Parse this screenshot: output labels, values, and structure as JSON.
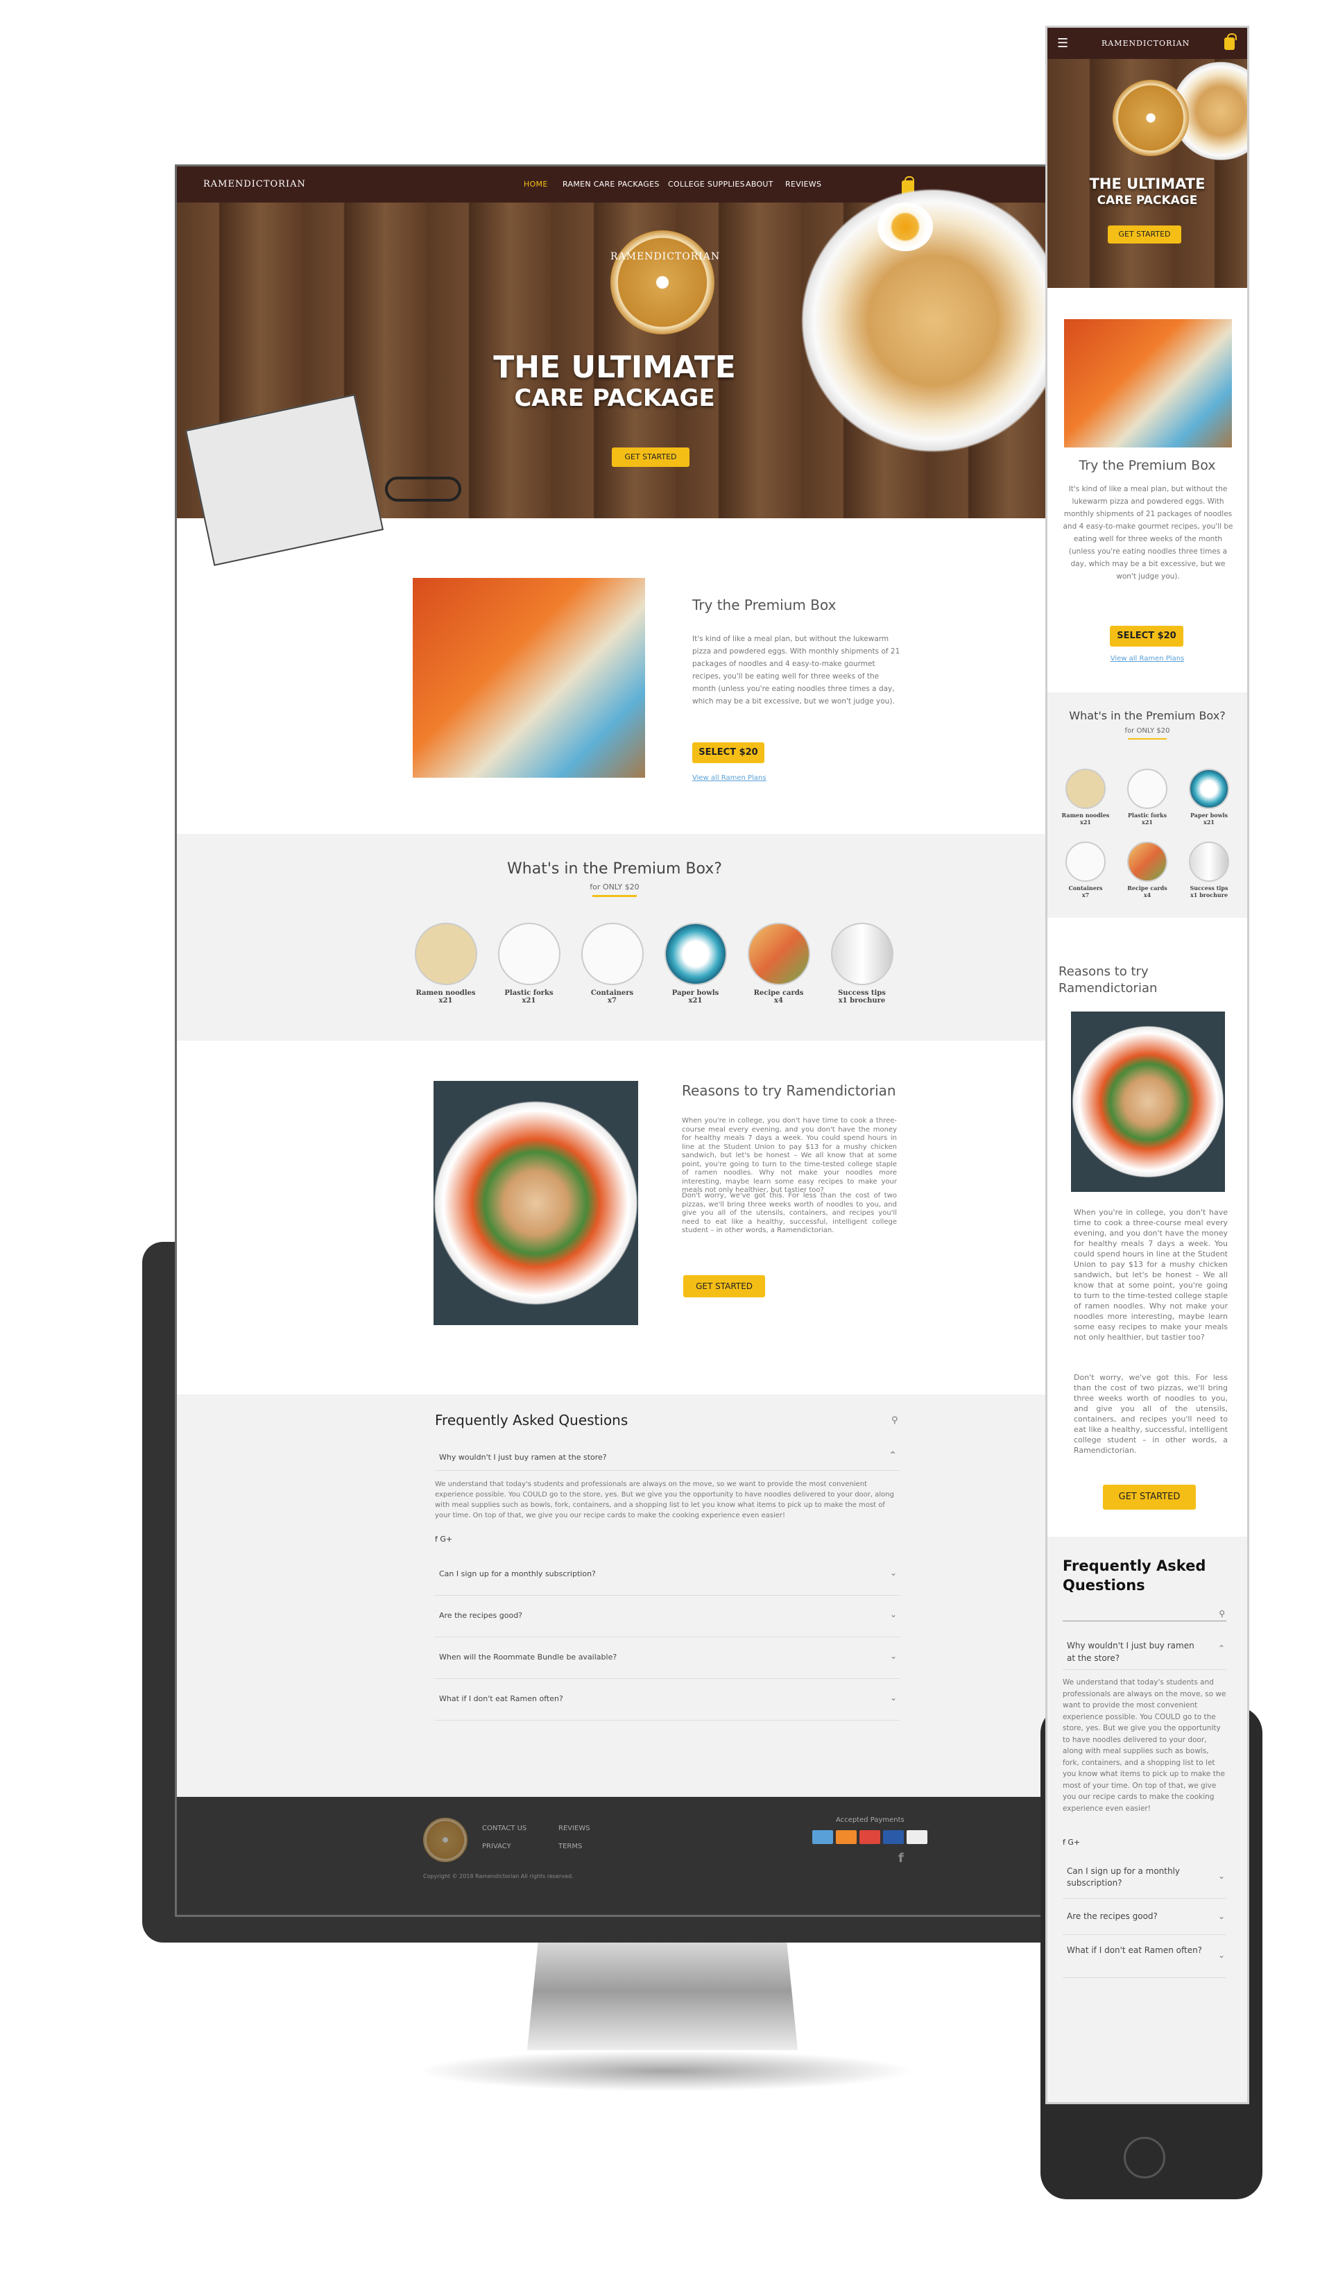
{
  "brand": "RAMENDICTORIAN",
  "nav": {
    "items": [
      "HOME",
      "RAMEN CARE PACKAGES",
      "COLLEGE SUPPLIES",
      "ABOUT",
      "REVIEWS"
    ],
    "active": "HOME"
  },
  "hero": {
    "logo_text": "RAMENDICTORIAN",
    "title_line1": "THE ULTIMATE",
    "title_line2": "CARE PACKAGE",
    "cta": "GET STARTED"
  },
  "premium": {
    "title": "Try the Premium Box",
    "body": "It's kind of like a meal plan, but without the lukewarm pizza and powdered eggs. With monthly shipments of 21 packages of noodles and 4 easy-to-make gourmet recipes, you'll be eating well for three weeks of the month (unless you're eating noodles three times a day, which may be a bit excessive, but we won't judge you).",
    "button": "SELECT $20",
    "link": "View all Ramen Plans"
  },
  "whats_in": {
    "title": "What's in the Premium Box?",
    "subtitle": "for ONLY $20",
    "items": [
      {
        "name": "Ramen noodles",
        "qty": "x21"
      },
      {
        "name": "Plastic forks",
        "qty": "x21"
      },
      {
        "name": "Containers",
        "qty": "x7"
      },
      {
        "name": "Paper bowls",
        "qty": "x21"
      },
      {
        "name": "Recipe cards",
        "qty": "x4"
      },
      {
        "name": "Success tips",
        "qty": "x1 brochure"
      }
    ]
  },
  "reasons": {
    "title": "Reasons to try Ramendictorian",
    "p1": "When you're in college, you don't have time to cook a three-course meal every evening, and you don't have the money for healthy meals 7 days a week. You could spend hours in line at the Student Union to pay $13 for a mushy chicken sandwich, but let's be honest – We all know that at some point, you're going to turn to the time-tested college staple of ramen noodles. Why not make your noodles more interesting, maybe learn some easy recipes to make your meals not only healthier, but tastier too?",
    "p2": "Don't worry, we've got this. For less than the cost of two pizzas, we'll bring three weeks worth of noodles to you, and give you all of the utensils, containers, and recipes you'll need to eat like a healthy, successful, intelligent college student – in other words, a Ramendictorian.",
    "button": "GET STARTED"
  },
  "faq": {
    "title": "Frequently Asked Questions",
    "open_question": "Why wouldn't I just buy ramen at the store?",
    "open_answer": "We understand that today's students and professionals are always on the move, so we want to provide the most convenient experience possible. You COULD go to the store, yes. But we give you the opportunity to have noodles delivered to your door, along with meal supplies such as bowls, fork, containers, and a shopping list to let you know what items to pick up to make the most of your time. On top of that, we give you our recipe cards to make the cooking experience even easier!",
    "share_icons": "f  G+",
    "questions": [
      "Can I sign up for a monthly subscription?",
      "Are the recipes good?",
      "When will the Roommate Bundle be available?",
      "What if I don't eat Ramen often?"
    ],
    "mobile_questions": [
      "Can I sign up for a monthly subscription?",
      "Are the recipes good?",
      "What if I don't eat Ramen often?"
    ]
  },
  "footer": {
    "links_col1": [
      "CONTACT US",
      "PRIVACY"
    ],
    "links_col2": [
      "REVIEWS",
      "TERMS"
    ],
    "payments_label": "Accepted Payments",
    "copyright": "Copyright © 2018 Ramendictorian All rights reserved."
  },
  "mobile": {
    "reasons_title_line1": "Reasons to try",
    "reasons_title_line2": "Ramendictorian",
    "faq_title_line1": "Frequently Asked",
    "faq_title_line2": "Questions",
    "faq_open_q_line1": "Why wouldn't I just buy ramen",
    "faq_open_q_line2": "at the store?"
  },
  "colors": {
    "nav": "#3d1f1a",
    "accent": "#f5be16",
    "footer": "#333333",
    "section_grey": "#f2f2f2"
  }
}
